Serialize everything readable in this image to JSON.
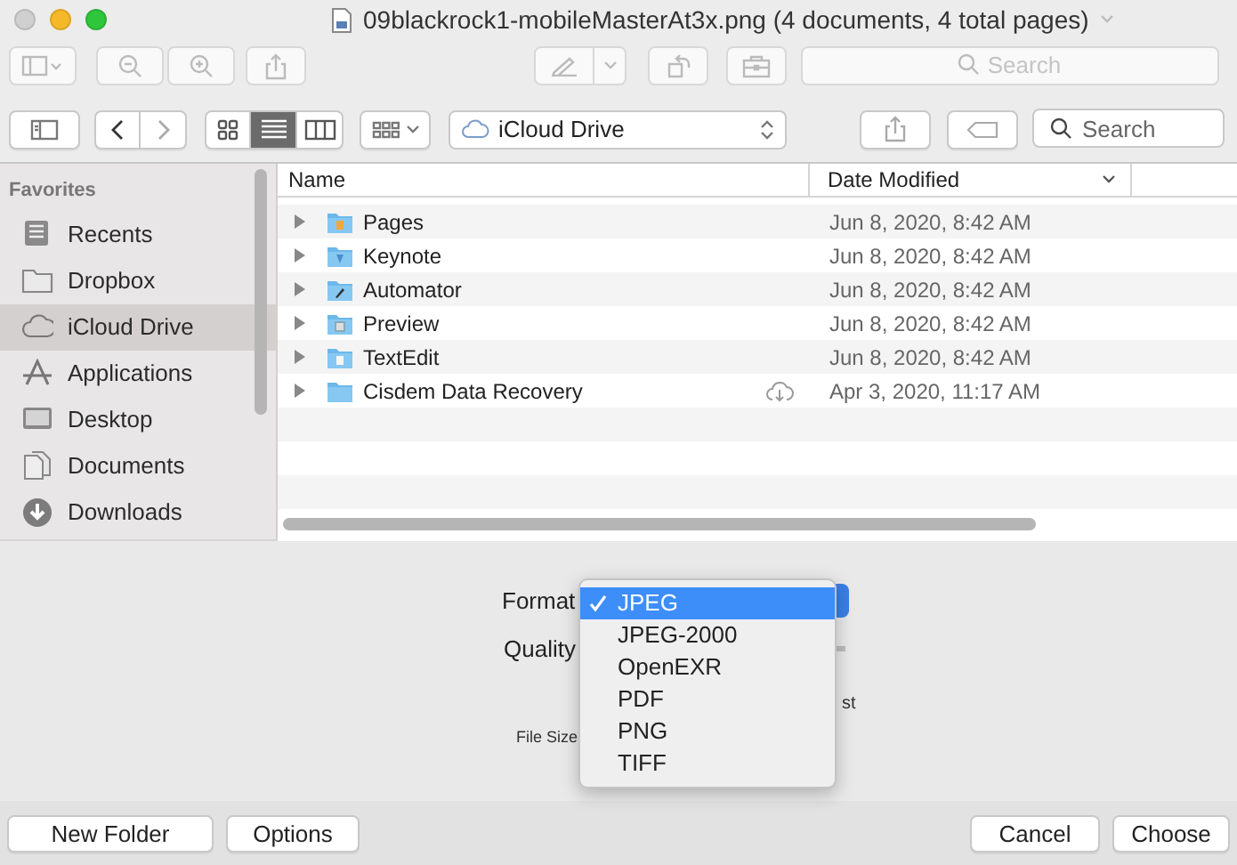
{
  "window": {
    "title": "09blackrock1-mobileMasterAt3x.png (4 documents, 4 total pages)"
  },
  "top_toolbar": {
    "search_placeholder": "Search"
  },
  "browser_toolbar": {
    "view_modes": [
      {
        "kind": "icons",
        "selected": false
      },
      {
        "kind": "list",
        "selected": true
      },
      {
        "kind": "columns",
        "selected": false
      }
    ],
    "location": "iCloud Drive",
    "search_placeholder": "Search"
  },
  "sidebar": {
    "heading": "Favorites",
    "items": [
      {
        "label": "Recents",
        "selected": false
      },
      {
        "label": "Dropbox",
        "selected": false
      },
      {
        "label": "iCloud Drive",
        "selected": true
      },
      {
        "label": "Applications",
        "selected": false
      },
      {
        "label": "Desktop",
        "selected": false
      },
      {
        "label": "Documents",
        "selected": false
      },
      {
        "label": "Downloads",
        "selected": false
      }
    ]
  },
  "table": {
    "columns": [
      "Name",
      "Date Modified"
    ],
    "rows": [
      {
        "name": "Pages",
        "date": "Jun 8, 2020, 8:42 AM",
        "in_cloud": false
      },
      {
        "name": "Keynote",
        "date": "Jun 8, 2020, 8:42 AM",
        "in_cloud": false
      },
      {
        "name": "Automator",
        "date": "Jun 8, 2020, 8:42 AM",
        "in_cloud": false
      },
      {
        "name": "Preview",
        "date": "Jun 8, 2020, 8:42 AM",
        "in_cloud": false
      },
      {
        "name": "TextEdit",
        "date": "Jun 8, 2020, 8:42 AM",
        "in_cloud": false
      },
      {
        "name": "Cisdem Data Recovery",
        "date": "Apr 3, 2020, 11:17 AM",
        "in_cloud": true
      }
    ]
  },
  "options": {
    "format_label": "Format",
    "quality_label": "Quality",
    "quality_hint": "st",
    "file_size_label": "File Size",
    "format_menu": [
      {
        "label": "JPEG",
        "selected": true
      },
      {
        "label": "JPEG-2000",
        "selected": false
      },
      {
        "label": "OpenEXR",
        "selected": false
      },
      {
        "label": "PDF",
        "selected": false
      },
      {
        "label": "PNG",
        "selected": false
      },
      {
        "label": "TIFF",
        "selected": false
      }
    ]
  },
  "footer": {
    "left_buttons": [
      "New Folder",
      "Options"
    ],
    "right_buttons": [
      "Cancel",
      "Choose"
    ]
  }
}
